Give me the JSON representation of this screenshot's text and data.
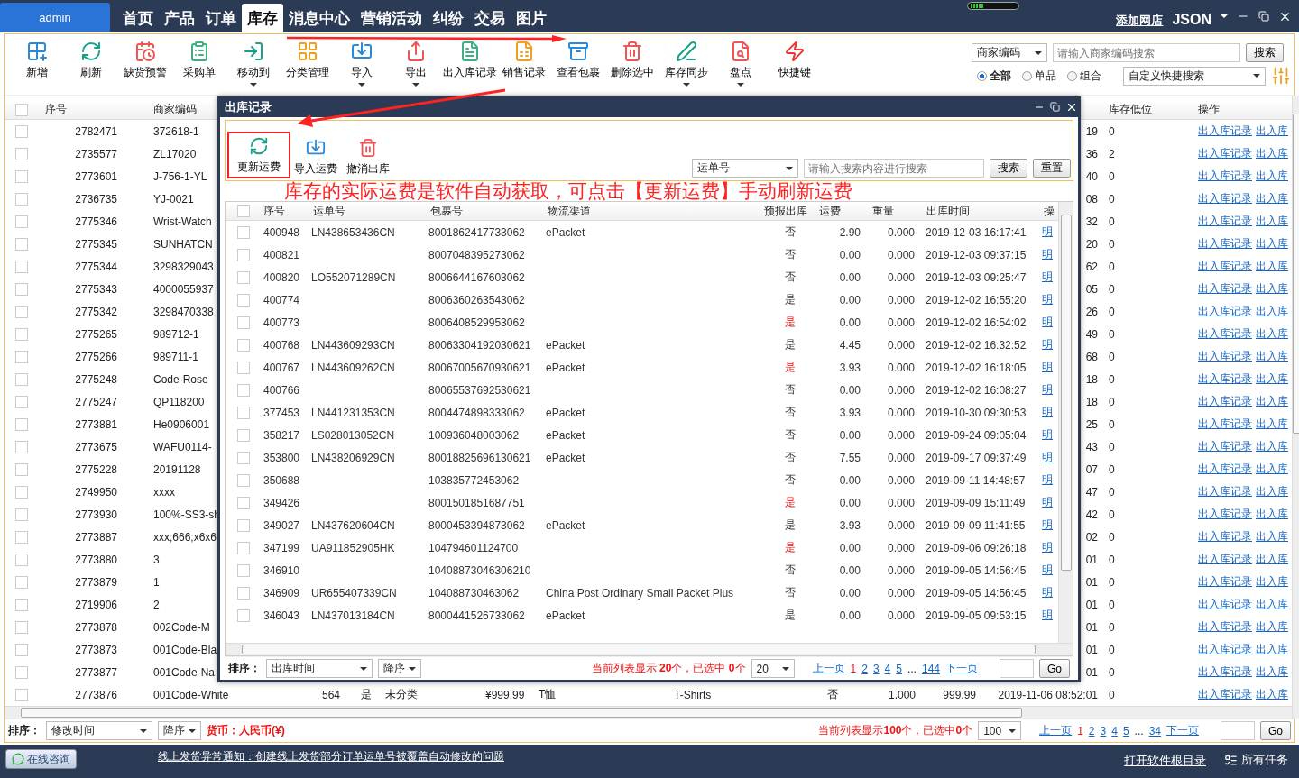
{
  "topbar": {
    "user": "admin",
    "nav": [
      {
        "label": "首页",
        "selected": false
      },
      {
        "label": "产品",
        "selected": false
      },
      {
        "label": "订单",
        "selected": false
      },
      {
        "label": "库存",
        "selected": true
      },
      {
        "label": "消息中心",
        "selected": false
      },
      {
        "label": "营销活动",
        "selected": false
      },
      {
        "label": "纠纷",
        "selected": false
      },
      {
        "label": "交易",
        "selected": false
      },
      {
        "label": "图片",
        "selected": false
      }
    ],
    "add_shop": "添加网店",
    "account": "JSON"
  },
  "toolbar": [
    {
      "label": "新增",
      "dropdown": false
    },
    {
      "label": "刷新",
      "dropdown": false
    },
    {
      "label": "缺货预警",
      "dropdown": false
    },
    {
      "label": "采购单",
      "dropdown": false
    },
    {
      "label": "移动到",
      "dropdown": true
    },
    {
      "label": "分类管理",
      "dropdown": false
    },
    {
      "label": "导入",
      "dropdown": true
    },
    {
      "label": "导出",
      "dropdown": true
    },
    {
      "label": "出入库记录",
      "dropdown": false
    },
    {
      "label": "销售记录",
      "dropdown": false
    },
    {
      "label": "查看包裹",
      "dropdown": false
    },
    {
      "label": "删除选中",
      "dropdown": false
    },
    {
      "label": "库存同步",
      "dropdown": true
    },
    {
      "label": "盘点",
      "dropdown": true
    },
    {
      "label": "快捷键",
      "dropdown": false
    }
  ],
  "search": {
    "field": "商家编码",
    "placeholder": "请输入商家编码搜索",
    "button": "搜索",
    "radios": [
      {
        "label": "全部",
        "selected": true
      },
      {
        "label": "单品",
        "selected": false
      },
      {
        "label": "组合",
        "selected": false
      }
    ],
    "quick": "自定义快捷搜索"
  },
  "table": {
    "all_checked": false,
    "header": {
      "seq": "序号",
      "code": "商家编码",
      "low": "库存低位",
      "ops": "操作"
    },
    "rows": [
      {
        "checked": false,
        "seq": "2782471",
        "code": "372618-1",
        "column_13": "19",
        "low": "0",
        "ops": [
          "出入库记录",
          "出入库"
        ]
      },
      {
        "checked": false,
        "seq": "2735577",
        "code": "ZL17020",
        "column_13": "36",
        "low": "2",
        "ops": [
          "出入库记录",
          "出入库"
        ]
      },
      {
        "checked": false,
        "seq": "2773601",
        "code": "J-756-1-YL",
        "column_13": "40",
        "low": "0",
        "ops": [
          "出入库记录",
          "出入库"
        ]
      },
      {
        "checked": false,
        "seq": "2736735",
        "code": "YJ-0021",
        "column_13": "08",
        "low": "0",
        "ops": [
          "出入库记录",
          "出入库"
        ]
      },
      {
        "checked": false,
        "seq": "2775346",
        "code": "Wrist-Watch",
        "column_13": "32",
        "low": "0",
        "ops": [
          "出入库记录",
          "出入库"
        ]
      },
      {
        "checked": false,
        "seq": "2775345",
        "code": "SUNHATCN",
        "column_13": "20",
        "low": "0",
        "ops": [
          "出入库记录",
          "出入库"
        ]
      },
      {
        "checked": false,
        "seq": "2775344",
        "code": "3298329043",
        "column_13": "62",
        "low": "0",
        "ops": [
          "出入库记录",
          "出入库"
        ]
      },
      {
        "checked": false,
        "seq": "2775343",
        "code": "4000055937",
        "column_13": "05",
        "low": "0",
        "ops": [
          "出入库记录",
          "出入库"
        ]
      },
      {
        "checked": false,
        "seq": "2775342",
        "code": "3298470338",
        "column_13": "26",
        "low": "0",
        "ops": [
          "出入库记录",
          "出入库"
        ]
      },
      {
        "checked": false,
        "seq": "2775265",
        "code": "989712-1",
        "column_13": "49",
        "low": "0",
        "ops": [
          "出入库记录",
          "出入库"
        ]
      },
      {
        "checked": false,
        "seq": "2775266",
        "code": "989711-1",
        "column_13": "68",
        "low": "0",
        "ops": [
          "出入库记录",
          "出入库"
        ]
      },
      {
        "checked": false,
        "seq": "2775248",
        "code": "Code-Rose",
        "column_13": "18",
        "low": "0",
        "ops": [
          "出入库记录",
          "出入库"
        ]
      },
      {
        "checked": false,
        "seq": "2775247",
        "code": "QP118200",
        "column_13": "18",
        "low": "0",
        "ops": [
          "出入库记录",
          "出入库"
        ]
      },
      {
        "checked": false,
        "seq": "2773881",
        "code": "He0906001",
        "column_13": "25",
        "low": "0",
        "ops": [
          "出入库记录",
          "出入库"
        ]
      },
      {
        "checked": false,
        "seq": "2773675",
        "code": "WAFU0114-",
        "column_13": "43",
        "low": "0",
        "ops": [
          "出入库记录",
          "出入库"
        ]
      },
      {
        "checked": false,
        "seq": "2775228",
        "code": "20191128",
        "column_13": "07",
        "low": "0",
        "ops": [
          "出入库记录",
          "出入库"
        ]
      },
      {
        "checked": false,
        "seq": "2749950",
        "code": "xxxx",
        "column_13": "47",
        "low": "0",
        "ops": [
          "出入库记录",
          "出入库"
        ]
      },
      {
        "checked": false,
        "seq": "2773930",
        "code": "100%-SS3-sh",
        "column_13": "42",
        "low": "0",
        "ops": [
          "出入库记录",
          "出入库"
        ]
      },
      {
        "checked": false,
        "seq": "2773887",
        "code": "xxx;666;x6x6",
        "column_13": "02",
        "low": "0",
        "ops": [
          "出入库记录",
          "出入库"
        ]
      },
      {
        "checked": false,
        "seq": "2773880",
        "code": "3",
        "column_13": "01",
        "low": "0",
        "ops": [
          "出入库记录",
          "出入库"
        ]
      },
      {
        "checked": false,
        "seq": "2773879",
        "code": "1",
        "column_13": "01",
        "low": "0",
        "ops": [
          "出入库记录",
          "出入库"
        ]
      },
      {
        "checked": false,
        "seq": "2719906",
        "code": "2",
        "column_13": "01",
        "low": "0",
        "ops": [
          "出入库记录",
          "出入库"
        ]
      },
      {
        "checked": false,
        "seq": "2773878",
        "code": "002Code-M",
        "column_13": "01",
        "low": "0",
        "ops": [
          "出入库记录",
          "出入库"
        ]
      },
      {
        "checked": false,
        "seq": "2773873",
        "code": "001Code-Bla",
        "column_13": "01",
        "low": "0",
        "ops": [
          "出入库记录",
          "出入库"
        ]
      },
      {
        "checked": false,
        "seq": "2773877",
        "code": "001Code-Na",
        "column_13": "01",
        "low": "0",
        "ops": [
          "出入库记录",
          "出入库"
        ]
      },
      {
        "checked": false,
        "seq": "2773876",
        "code": "001Code-White",
        "column_4": "564",
        "column_5": "是",
        "column_6": "未分类",
        "column_7": "¥999.99",
        "column_8": "T恤",
        "column_9": "T-Shirts",
        "column_10": "否",
        "column_11": "1.000",
        "column_12": "999.99",
        "column_13": "2019-11-06 08:52:01",
        "low": "0",
        "ops": [
          "出入库记录",
          "出入库"
        ]
      }
    ]
  },
  "sort_bar": {
    "label": "排序：",
    "field": "修改时间",
    "order": "降序",
    "currency": "货币：人民币(¥)",
    "summary": "当前列表显示**100**个，已选中**0**个",
    "page_size": "100",
    "pager": {
      "prev": "上一页",
      "pages": [
        {
          "label": "1",
          "selected": true
        },
        {
          "label": "2",
          "selected": false
        },
        {
          "label": "3",
          "selected": false
        },
        {
          "label": "4",
          "selected": false
        },
        {
          "label": "5",
          "selected": false
        }
      ],
      "ellipsis": "...",
      "last": "34",
      "next": "下一页",
      "go": "Go"
    }
  },
  "status_bar": {
    "consult": "在线咨询",
    "notice": "线上发货异常通知：创建线上发货部分订单运单号被覆盖自动修改的问题",
    "open_dir": "打开软件根目录",
    "tasks": "所有任务"
  },
  "dialog": {
    "title": "出库记录",
    "tools": [
      {
        "label": "更新运费",
        "highlighted": true
      },
      {
        "label": "导入运费",
        "highlighted": false
      },
      {
        "label": "撤消出库",
        "highlighted": false
      }
    ],
    "search_field": "运单号",
    "placeholder": "请输入搜索内容进行搜索",
    "search": "搜索",
    "reset": "重置",
    "annotation": "库存的实际运费是软件自动获取，可点击【更新运费】手动刷新运费",
    "all_checked": false,
    "columns": [
      "序号",
      "运单号",
      "包裹号",
      "物流渠道",
      "预报出库",
      "运费",
      "重量",
      "出库时间",
      "操"
    ],
    "rows": [
      {
        "checked": false,
        "seq": "400948",
        "waybill": "LN438653436CN",
        "package": "8001862417733062",
        "channel": "ePacket",
        "forecast": "否",
        "alert": false,
        "fee": "2.90",
        "weight": "0.000",
        "time": "2019-12-03 16:17:41",
        "op": "明"
      },
      {
        "checked": false,
        "seq": "400821",
        "package": "8007048395273062",
        "forecast": "否",
        "alert": false,
        "fee": "0.00",
        "weight": "0.000",
        "time": "2019-12-03 09:37:15",
        "op": "明"
      },
      {
        "checked": false,
        "seq": "400820",
        "waybill": "LO552071289CN",
        "package": "8006644167603062",
        "forecast": "否",
        "alert": false,
        "fee": "0.00",
        "weight": "0.000",
        "time": "2019-12-03 09:25:47",
        "op": "明"
      },
      {
        "checked": false,
        "seq": "400774",
        "package": "8006360263543062",
        "forecast": "是",
        "alert": false,
        "fee": "0.00",
        "weight": "0.000",
        "time": "2019-12-02 16:55:20",
        "op": "明"
      },
      {
        "checked": false,
        "seq": "400773",
        "package": "8006408529953062",
        "forecast": "是",
        "alert": true,
        "fee": "0.00",
        "weight": "0.000",
        "time": "2019-12-02 16:54:02",
        "op": "明"
      },
      {
        "checked": false,
        "seq": "400768",
        "waybill": "LN443609293CN",
        "package": "80063304192030621",
        "channel": "ePacket",
        "forecast": "是",
        "alert": false,
        "fee": "4.45",
        "weight": "0.000",
        "time": "2019-12-02 16:32:52",
        "op": "明"
      },
      {
        "checked": false,
        "seq": "400767",
        "waybill": "LN443609262CN",
        "package": "80067005670930621",
        "channel": "ePacket",
        "forecast": "是",
        "alert": true,
        "fee": "3.93",
        "weight": "0.000",
        "time": "2019-12-02 16:18:05",
        "op": "明"
      },
      {
        "checked": false,
        "seq": "400766",
        "package": "80065537692530621",
        "forecast": "否",
        "alert": false,
        "fee": "0.00",
        "weight": "0.000",
        "time": "2019-12-02 16:08:27",
        "op": "明"
      },
      {
        "checked": false,
        "seq": "377453",
        "waybill": "LN441231353CN",
        "package": "8004474898333062",
        "channel": "ePacket",
        "forecast": "否",
        "alert": false,
        "fee": "3.93",
        "weight": "0.000",
        "time": "2019-10-30 09:30:53",
        "op": "明"
      },
      {
        "checked": false,
        "seq": "358217",
        "waybill": "LS028013052CN",
        "package": "100936048003062",
        "channel": "ePacket",
        "forecast": "否",
        "alert": false,
        "fee": "0.00",
        "weight": "0.000",
        "time": "2019-09-24 09:05:04",
        "op": "明"
      },
      {
        "checked": false,
        "seq": "353800",
        "waybill": "LN438206929CN",
        "package": "80018825696130621",
        "channel": "ePacket",
        "forecast": "否",
        "alert": false,
        "fee": "7.55",
        "weight": "0.000",
        "time": "2019-09-17 09:37:49",
        "op": "明"
      },
      {
        "checked": false,
        "seq": "350688",
        "package": "103835772453062",
        "forecast": "否",
        "alert": false,
        "fee": "0.00",
        "weight": "0.000",
        "time": "2019-09-11 14:48:57",
        "op": "明"
      },
      {
        "checked": false,
        "seq": "349426",
        "package": "8001501851687751",
        "forecast": "是",
        "alert": true,
        "fee": "0.00",
        "weight": "0.000",
        "time": "2019-09-09 15:11:49",
        "op": "明"
      },
      {
        "checked": false,
        "seq": "349027",
        "waybill": "LN437620604CN",
        "package": "8000453394873062",
        "channel": "ePacket",
        "forecast": "是",
        "alert": false,
        "fee": "3.93",
        "weight": "0.000",
        "time": "2019-09-09 11:41:55",
        "op": "明"
      },
      {
        "checked": false,
        "seq": "347199",
        "waybill": "UA911852905HK",
        "package": "104794601124700",
        "forecast": "是",
        "alert": true,
        "fee": "0.00",
        "weight": "0.000",
        "time": "2019-09-06 09:26:18",
        "op": "明"
      },
      {
        "checked": false,
        "seq": "346910",
        "package": "10408873046306210",
        "forecast": "否",
        "alert": false,
        "fee": "0.00",
        "weight": "0.000",
        "time": "2019-09-05 14:56:45",
        "op": "明"
      },
      {
        "checked": false,
        "seq": "346909",
        "waybill": "UR655407339CN",
        "package": "104088730463062",
        "channel": "China Post Ordinary Small Packet Plus",
        "forecast": "否",
        "alert": false,
        "fee": "0.00",
        "weight": "0.000",
        "time": "2019-09-05 14:56:45",
        "op": "明"
      },
      {
        "checked": false,
        "seq": "346043",
        "waybill": "LN437013184CN",
        "package": "8000441526733062",
        "channel": "ePacket",
        "forecast": "是",
        "alert": false,
        "fee": "0.00",
        "weight": "0.000",
        "time": "2019-09-05 09:53:15",
        "op": "明"
      }
    ],
    "sort_bar": {
      "label": "排序：",
      "field": "出库时间",
      "order": "降序",
      "summary": "当前列表显示 **20**个，已选中 **0**个",
      "page_size": "20",
      "pager": {
        "prev": "上一页",
        "pages": [
          {
            "label": "1",
            "selected": true
          },
          {
            "label": "2",
            "selected": false
          },
          {
            "label": "3",
            "selected": false
          },
          {
            "label": "4",
            "selected": false
          },
          {
            "label": "5",
            "selected": false
          }
        ],
        "ellipsis": "...",
        "last": "144",
        "next": "下一页",
        "go": "Go"
      }
    }
  }
}
